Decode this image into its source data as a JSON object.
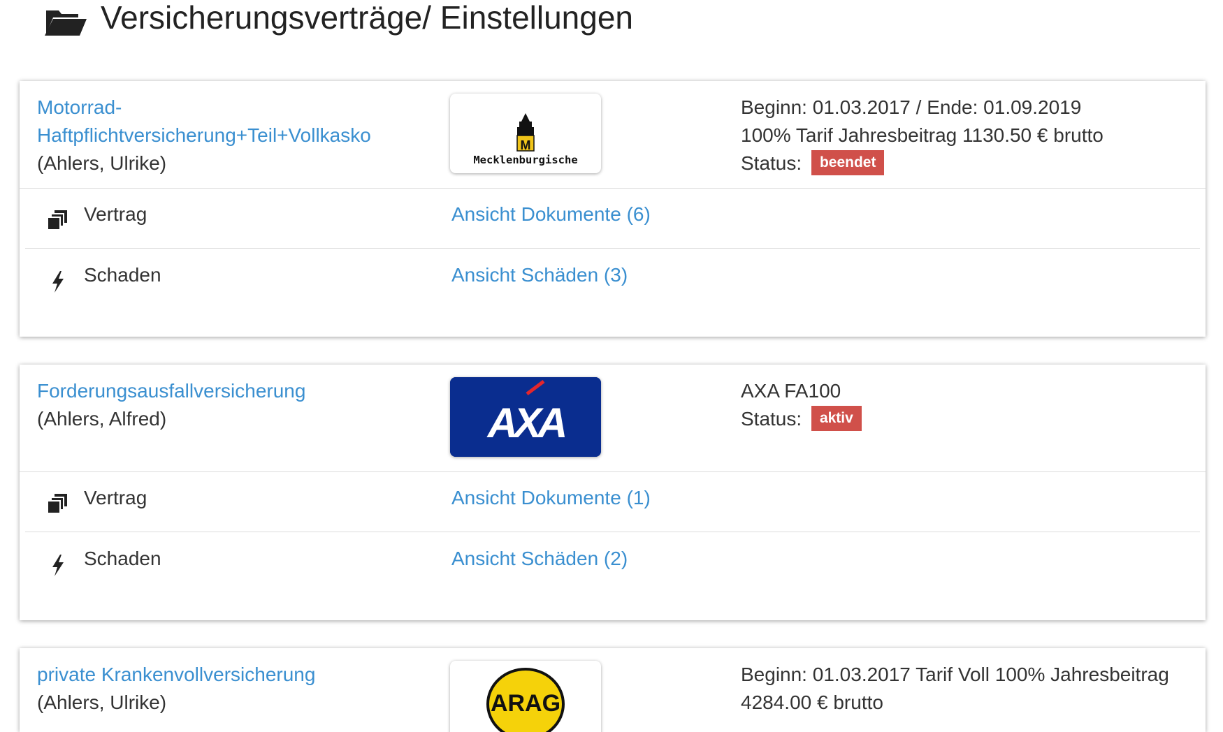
{
  "page": {
    "title": "Versicherungsverträge/ Einstellungen"
  },
  "colors": {
    "link": "#3a8fd0",
    "badge_beendet": "#d0504a",
    "badge_aktiv": "#d0504a",
    "axa_blue": "#0a2d8f",
    "arag_yellow": "#f5d20a"
  },
  "contracts": [
    {
      "name": "Motorrad-Haftpflichtversicherung+Teil+Vollkasko",
      "owner": "(Ahlers, Ulrike)",
      "logo_text": "Mecklenburgische",
      "info_lines": [
        "Beginn: 01.03.2017 / Ende: 01.09.2019",
        "100% Tarif Jahresbeitrag 1130.50 € brutto"
      ],
      "status_label": "Status:",
      "status": "beendet",
      "rows": [
        {
          "label": "Vertrag",
          "link": "Ansicht Dokumente (6)",
          "icon": "documents-icon"
        },
        {
          "label": "Schaden",
          "link": "Ansicht Schäden (3)",
          "icon": "bolt-icon"
        }
      ]
    },
    {
      "name": "Forderungsausfallversicherung",
      "owner": "(Ahlers, Alfred)",
      "logo_text": "AXA",
      "info_lines": [
        "AXA FA100"
      ],
      "status_label": "Status:",
      "status": "aktiv",
      "rows": [
        {
          "label": "Vertrag",
          "link": "Ansicht Dokumente (1)",
          "icon": "documents-icon"
        },
        {
          "label": "Schaden",
          "link": "Ansicht Schäden (2)",
          "icon": "bolt-icon"
        }
      ]
    },
    {
      "name": "private Krankenvollversicherung",
      "owner": "(Ahlers, Ulrike)",
      "logo_text": "ARAG",
      "info_lines": [
        "Beginn: 01.03.2017 Tarif Voll 100% Jahresbeitrag 4284.00 € brutto"
      ]
    }
  ]
}
